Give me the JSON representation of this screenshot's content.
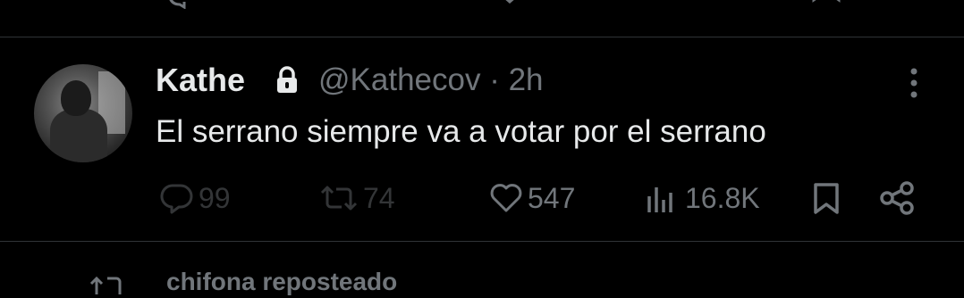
{
  "tweet": {
    "display_name": "Kathe",
    "handle": "@Kathecov",
    "separator": "·",
    "time": "2h",
    "text": "El serrano siempre va a votar por el serrano",
    "replies": "99",
    "reposts": "74",
    "likes": "547",
    "views": "16.8K"
  },
  "next_item": {
    "label": "chifona reposteado"
  },
  "icons": {
    "protected": "lock-icon",
    "more": "more-vertical-icon",
    "reply": "reply-icon",
    "repost": "repost-icon",
    "like": "heart-icon",
    "views": "views-icon",
    "bookmark": "bookmark-icon",
    "share": "share-icon"
  },
  "colors": {
    "background": "#000000",
    "primary_text": "#e7e9ea",
    "secondary_text": "#71767b",
    "divider": "#2f3336"
  }
}
